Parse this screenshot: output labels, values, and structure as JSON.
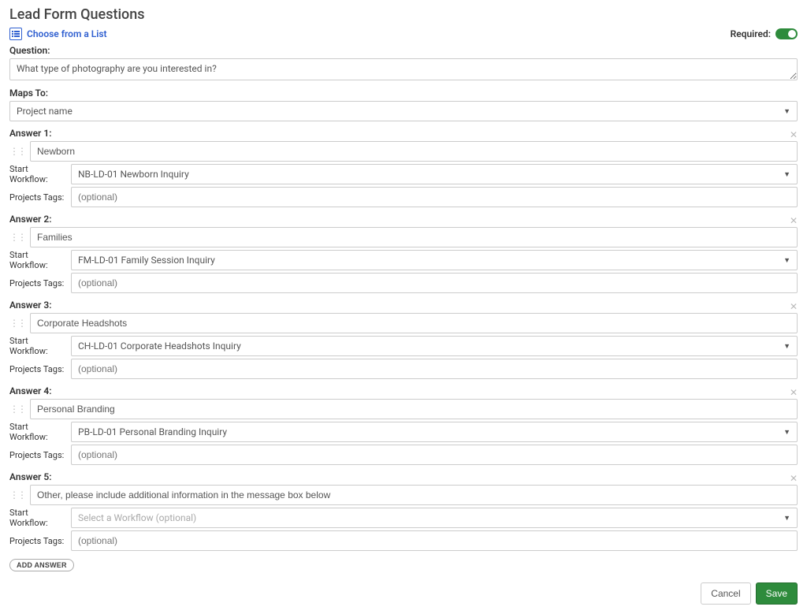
{
  "page_title": "Lead Form Questions",
  "choose_link": "Choose from a List",
  "required_label": "Required:",
  "question_label": "Question:",
  "question_value": "What type of photography are you interested in?",
  "maps_to_label": "Maps To:",
  "maps_to_value": "Project name",
  "sub_labels": {
    "start_workflow": "Start Workflow:",
    "projects_tags": "Projects Tags:"
  },
  "placeholders": {
    "tags": "(optional)",
    "workflow": "Select a Workflow (optional)"
  },
  "answers": [
    {
      "label": "Answer 1:",
      "value": "Newborn",
      "workflow": "NB-LD-01 Newborn Inquiry",
      "tags": ""
    },
    {
      "label": "Answer 2:",
      "value": "Families",
      "workflow": "FM-LD-01 Family Session Inquiry",
      "tags": ""
    },
    {
      "label": "Answer 3:",
      "value": "Corporate Headshots",
      "workflow": "CH-LD-01 Corporate Headshots Inquiry",
      "tags": ""
    },
    {
      "label": "Answer 4:",
      "value": "Personal Branding",
      "workflow": "PB-LD-01 Personal Branding Inquiry",
      "tags": ""
    },
    {
      "label": "Answer 5:",
      "value": "Other, please include additional information in the message box below",
      "workflow": "",
      "tags": ""
    }
  ],
  "add_answer_label": "ADD ANSWER",
  "cancel_label": "Cancel",
  "save_label": "Save"
}
